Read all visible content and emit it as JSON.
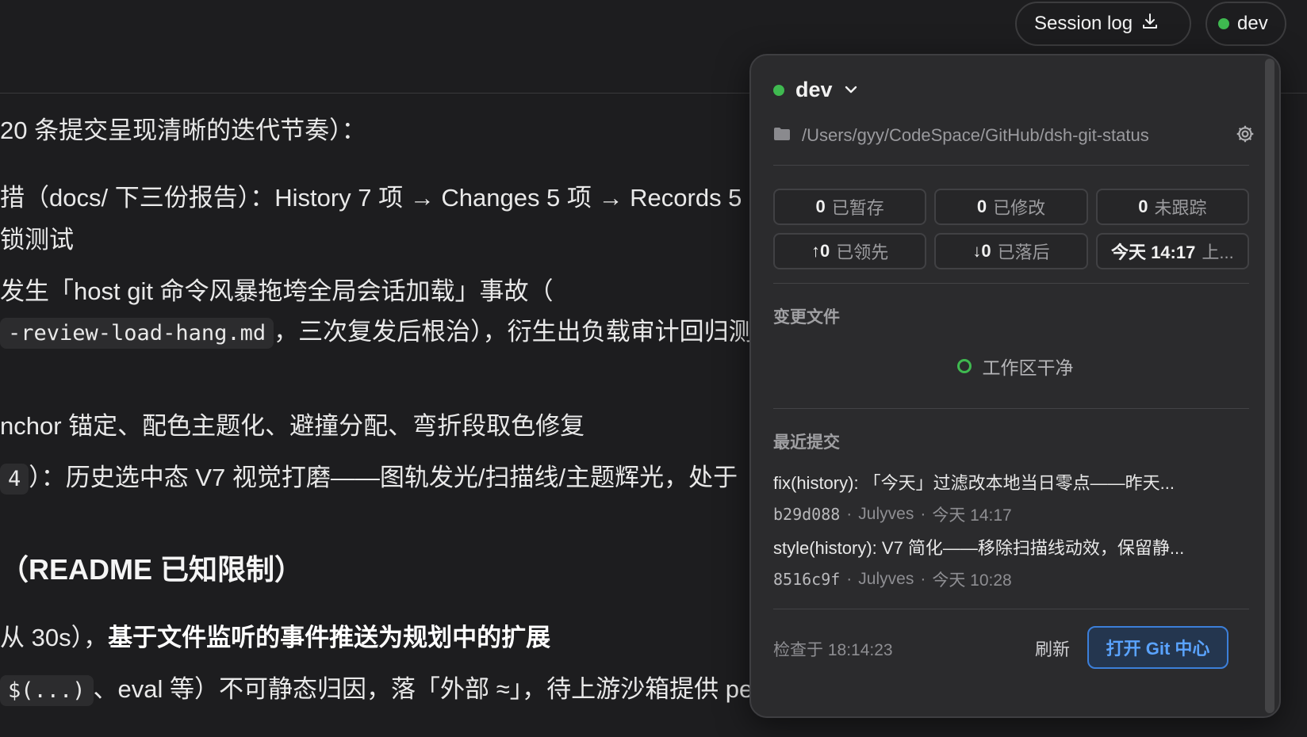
{
  "topbar": {
    "session_log_label": "Session log",
    "download_icon": "download-icon",
    "branch_pill_label": "dev",
    "status_color": "#3fb950"
  },
  "document": {
    "lines": [
      "20 条提交呈现清晰的迭代节奏）：",
      "措（docs/ 下三份报告）：History 7 项 → Changes 5 项 → Records 5",
      "锁测试",
      "发生「host git 命令风暴拖垮全局会话加载」事故（",
      "-review-load-hang.md",
      "，三次复发后根治），衍生出负载审计回归测",
      "nchor 锚定、配色主题化、避撞分配、弯折段取色修复",
      "4",
      "）：历史选中态 V7 视觉打磨——图轨发光/扫描线/主题辉光，处于",
      "（README 已知限制）",
      "从 30s），",
      "基于文件监听的事件推送为规划中的扩展",
      "$(...)",
      "、eval 等）不可静态归因，落「外部 ≈」，待上游沙箱提供 per-turn 权威写"
    ]
  },
  "panel": {
    "branch": "dev",
    "repo_path": "/Users/gyy/CodeSpace/GitHub/dsh-git-status",
    "stats": [
      {
        "num": "0",
        "label": "已暂存"
      },
      {
        "num": "0",
        "label": "已修改"
      },
      {
        "num": "0",
        "label": "未跟踪"
      },
      {
        "num": "↑0",
        "label": "已领先"
      },
      {
        "num": "↓0",
        "label": "已落后"
      },
      {
        "num": "今天 14:17",
        "label": "上..."
      }
    ],
    "changes_title": "变更文件",
    "clean_text": "工作区干净",
    "recent_title": "最近提交",
    "commits": [
      {
        "message": "fix(history): 「今天」过滤改本地当日零点——昨天...",
        "hash": "b29d088",
        "author": "Julyves",
        "time": "今天 14:17"
      },
      {
        "message": "style(history): V7 简化——移除扫描线动效，保留静...",
        "hash": "8516c9f",
        "author": "Julyves",
        "time": "今天 10:28"
      }
    ],
    "meta_sep": "·",
    "checked_at": "检查于 18:14:23",
    "refresh_label": "刷新",
    "open_git_label": "打开 Git 中心",
    "accent_color": "#3c7fd9"
  }
}
